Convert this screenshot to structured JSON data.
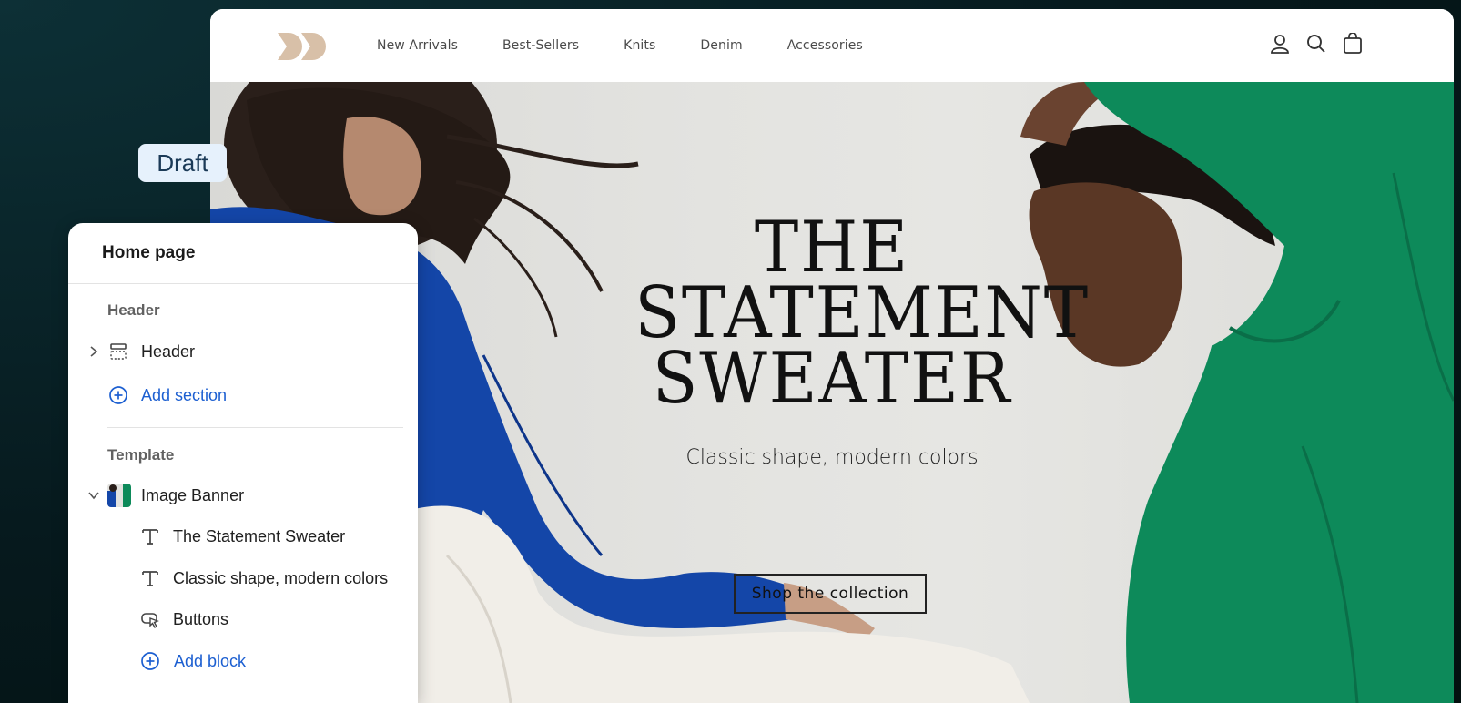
{
  "store": {
    "nav": [
      "New Arrivals",
      "Best-Sellers",
      "Knits",
      "Denim",
      "Accessories"
    ],
    "icons": [
      "account-icon",
      "search-icon",
      "cart-icon"
    ]
  },
  "hero": {
    "title_lines": [
      "THE",
      "STATEMENT",
      "SWEATER"
    ],
    "subtitle": "Classic shape, modern colors",
    "button": "Shop the collection"
  },
  "badge": {
    "label": "Draft"
  },
  "editor": {
    "title": "Home page",
    "header_group": "Header",
    "header_item": "Header",
    "add_section": "Add section",
    "template_group": "Template",
    "image_banner": "Image Banner",
    "blocks": [
      "The Statement Sweater",
      "Classic shape, modern colors",
      "Buttons"
    ],
    "add_block": "Add block"
  },
  "colors": {
    "accent_link": "#1c5fd1",
    "badge_bg": "#e6f1fc",
    "logo": "#d8c0a8",
    "blue_sweater": "#1446a8",
    "green_sweater": "#0d8a5a"
  }
}
